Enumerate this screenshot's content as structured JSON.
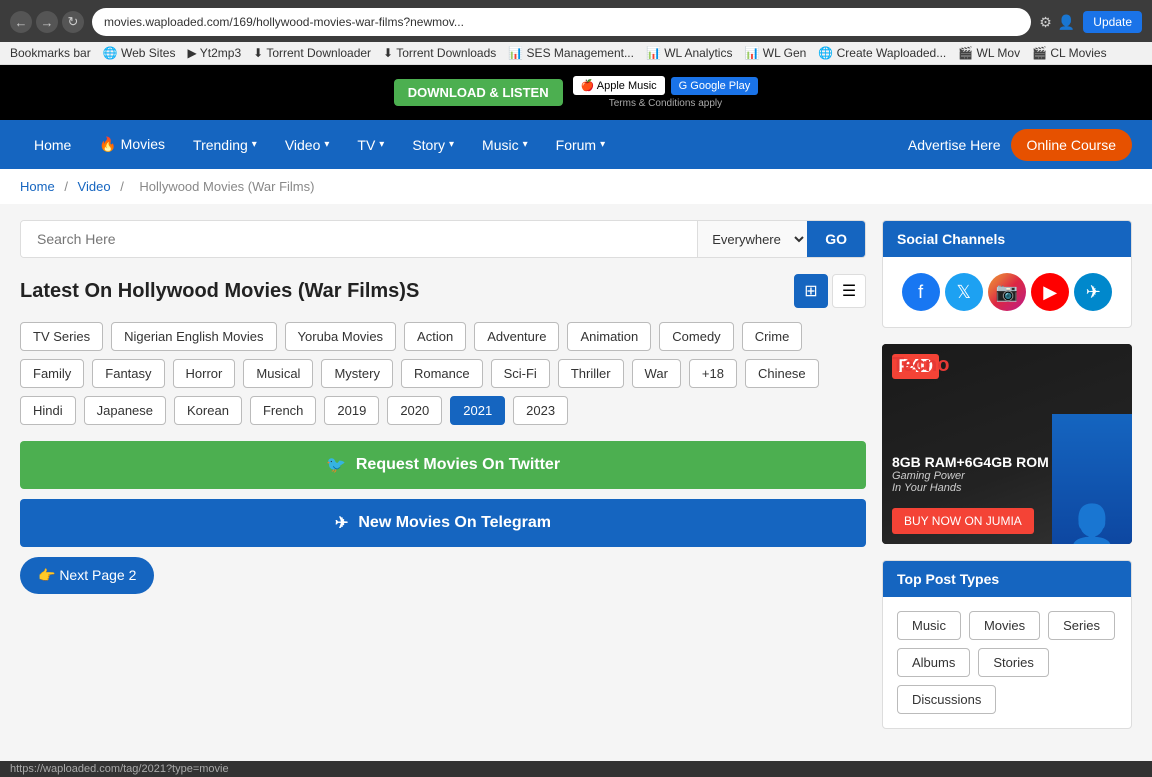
{
  "browser": {
    "url": "movies.waploaded.com/169/hollywood-movies-war-films?newmov...",
    "update_label": "Update",
    "nav_back": "←",
    "nav_forward": "→",
    "nav_refresh": "↻"
  },
  "bookmarks": {
    "bar_label": "Bookmarks bar",
    "items": [
      "Web Sites",
      "Yt2mp3",
      "Torrent Downloader",
      "Torrent Downloads",
      "SES Management...",
      "WL Analytics",
      "WL Gen",
      "Create Waploaded...",
      "WL Mov",
      "CL Movies"
    ]
  },
  "nav": {
    "home": "Home",
    "movies": "🔥 Movies",
    "trending": "Trending",
    "video": "Video",
    "tv": "TV",
    "story": "Story",
    "music": "Music",
    "forum": "Forum",
    "advertise": "Advertise Here",
    "online_course": "Online Course"
  },
  "breadcrumb": {
    "home": "Home",
    "video": "Video",
    "current": "Hollywood Movies (War Films)"
  },
  "search": {
    "placeholder": "Search Here",
    "location": "Everywhere",
    "go_label": "GO"
  },
  "page": {
    "title": "Latest On Hollywood Movies (War Films)S",
    "view_grid_label": "⊞",
    "view_list_label": "☰"
  },
  "filters": {
    "row1": [
      "TV Series",
      "Nigerian English Movies",
      "Yoruba Movies",
      "Action",
      "Adventure",
      "Animation"
    ],
    "row2": [
      "Comedy",
      "Crime",
      "Family",
      "Fantasy",
      "Horror",
      "Musical",
      "Mystery",
      "Romance",
      "Sci-Fi"
    ],
    "row3": [
      "Thriller",
      "War",
      "+18",
      "Chinese",
      "Hindi",
      "Japanese",
      "Korean",
      "French",
      "2019",
      "2020"
    ],
    "row4": [
      "2021",
      "2023"
    ],
    "active": "2021"
  },
  "cta": {
    "twitter_label": "Request Movies On Twitter",
    "telegram_label": "New Movies On Telegram",
    "twitter_icon": "🐦",
    "telegram_icon": "✈"
  },
  "pagination": {
    "next_label": "👉 Next Page 2"
  },
  "sidebar": {
    "social_channels_header": "Social Channels",
    "top_post_types_header": "Top Post Types",
    "post_types": [
      "Music",
      "Movies",
      "Series",
      "Albums",
      "Stories",
      "Discussions"
    ],
    "social_links": [
      "facebook",
      "twitter",
      "instagram",
      "youtube",
      "telegram"
    ]
  },
  "status_bar": {
    "url": "https://waploaded.com/tag/2021?type=movie"
  }
}
